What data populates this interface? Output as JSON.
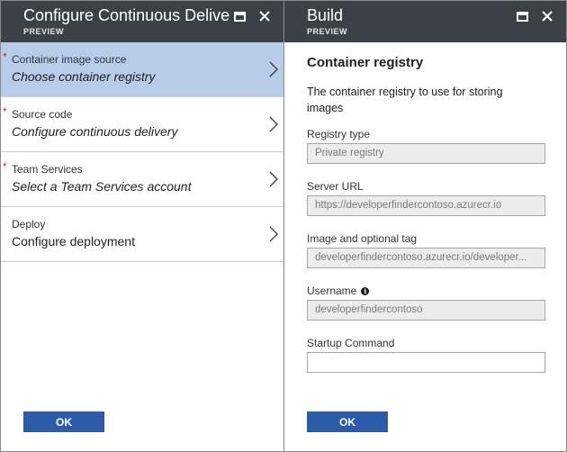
{
  "left_blade": {
    "title": "Configure Continuous Delive...",
    "subtitle": "PREVIEW",
    "steps": [
      {
        "label": "Container image source",
        "value": "Choose container registry",
        "required": "*"
      },
      {
        "label": "Source code",
        "value": "Configure continuous delivery",
        "required": "*"
      },
      {
        "label": "Team Services",
        "value": "Select a Team Services account",
        "required": "*"
      },
      {
        "label": "Deploy",
        "value": "Configure deployment",
        "required": ""
      }
    ],
    "ok_label": "OK"
  },
  "right_blade": {
    "title": "Build",
    "subtitle": "PREVIEW",
    "section_title": "Container registry",
    "section_desc": "The container registry to use for storing images",
    "fields": {
      "registry_type": {
        "label": "Registry type",
        "value": "Private registry"
      },
      "server_url": {
        "label": "Server URL",
        "value": "https://developerfindercontoso.azurecr.io"
      },
      "image_tag": {
        "label": "Image and optional tag",
        "value": "developerfindercontoso.azurecr.io/developer..."
      },
      "username": {
        "label": "Username",
        "value": "developerfindercontoso"
      },
      "startup_command": {
        "label": "Startup Command",
        "value": ""
      }
    },
    "ok_label": "OK"
  },
  "icons": {
    "maximize": "maximize-icon",
    "close": "close-icon",
    "chevron": "chevron-right-icon",
    "info": "info-icon"
  },
  "colors": {
    "header_bg": "#3c4047",
    "active_step_bg": "#b7cce8",
    "primary_button": "#2c5ba8",
    "required_marker": "#c4262e"
  }
}
